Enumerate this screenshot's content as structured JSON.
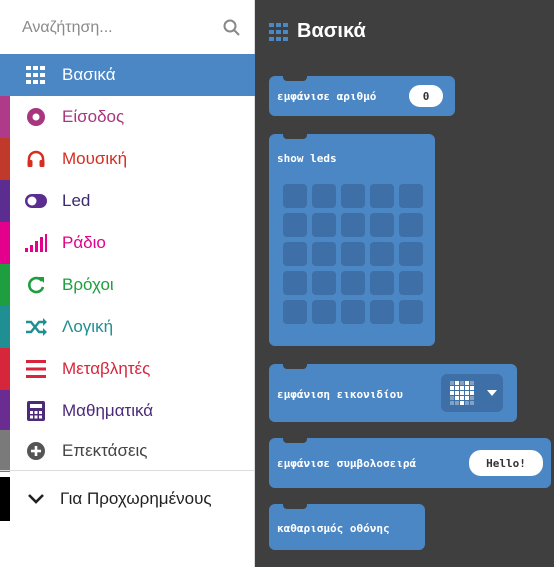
{
  "search": {
    "placeholder": "Αναζήτηση...",
    "icon": "search-icon"
  },
  "categories": [
    {
      "label": "Βασικά",
      "color": "#1e90ff",
      "text_color": "#ffffff",
      "icon": "grid-icon",
      "selected": true
    },
    {
      "label": "Είσοδος",
      "color": "#c63aa3",
      "text_color": "#c63aa3",
      "icon": "input-icon"
    },
    {
      "label": "Μουσική",
      "color": "#e63022",
      "text_color": "#e63022",
      "icon": "headphones-icon"
    },
    {
      "label": "Led",
      "color": "#5c2d91",
      "text_color": "#5c2d91",
      "icon": "toggle-icon"
    },
    {
      "label": "Ράδιο",
      "color": "#e3008c",
      "text_color": "#e3008c",
      "icon": "signal-bars-icon"
    },
    {
      "label": "Βρόχοι",
      "color": "#00aa00",
      "text_color": "#00aa00",
      "icon": "refresh-icon"
    },
    {
      "label": "Λογική",
      "color": "#00a4a6",
      "text_color": "#00a4a6",
      "icon": "shuffle-icon"
    },
    {
      "label": "Μεταβλητές",
      "color": "#dc143c",
      "text_color": "#dc143c",
      "icon": "list-icon"
    },
    {
      "label": "Μαθηματικά",
      "color": "#9400d3",
      "text_color": "#5c2d91",
      "icon": "calculator-icon"
    },
    {
      "label": "Επεκτάσεις",
      "color": "#757575",
      "text_color": "#444444",
      "icon": "plus-circle-icon"
    }
  ],
  "advanced": {
    "label": "Για Προχωρημένους",
    "icon": "chevron-down-icon"
  },
  "flyout": {
    "title": "Βασικά",
    "blocks": {
      "show_number": {
        "label": "εμφάνισε αριθμό",
        "value": "0"
      },
      "show_leds": {
        "label": "show leds"
      },
      "show_icon": {
        "label": "εμφάνιση εικονιδίου",
        "icon": "heart-icon"
      },
      "show_string": {
        "label": "εμφάνισε συμβολοσειρά",
        "value": "Hello!"
      },
      "clear_screen": {
        "label": "καθαρισμός οθόνης"
      }
    }
  },
  "colors": {
    "accent": "#4c87c5",
    "flyout_bg": "#3f3f3f",
    "led_off": "#3e6fa6"
  }
}
